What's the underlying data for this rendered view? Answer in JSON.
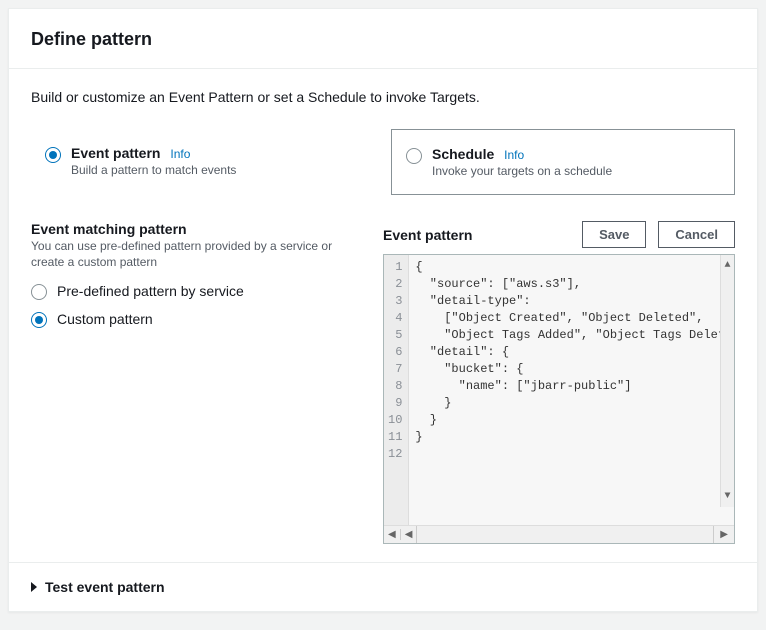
{
  "header": {
    "title": "Define pattern"
  },
  "intro": "Build or customize an Event Pattern or set a Schedule to invoke Targets.",
  "modes": {
    "event_pattern": {
      "title": "Event pattern",
      "info": "Info",
      "desc": "Build a pattern to match events",
      "selected": true
    },
    "schedule": {
      "title": "Schedule",
      "info": "Info",
      "desc": "Invoke your targets on a schedule",
      "selected": false
    }
  },
  "matching": {
    "title": "Event matching pattern",
    "sub": "You can use pre-defined pattern provided by a service or create a custom pattern",
    "options": {
      "predefined": {
        "label": "Pre-defined pattern by service",
        "selected": false
      },
      "custom": {
        "label": "Custom pattern",
        "selected": true
      }
    }
  },
  "editor": {
    "title": "Event pattern",
    "buttons": {
      "save": "Save",
      "cancel": "Cancel"
    },
    "lines": [
      "{",
      "  \"source\": [\"aws.s3\"],",
      "  \"detail-type\":",
      "    [\"Object Created\", \"Object Deleted\",",
      "    \"Object Tags Added\", \"Object Tags Deleted\"]",
      "  \"detail\": {",
      "    \"bucket\": {",
      "      \"name\": [\"jbarr-public\"]",
      "    }",
      "  }",
      "}",
      ""
    ]
  },
  "footer": {
    "test": "Test event pattern"
  }
}
